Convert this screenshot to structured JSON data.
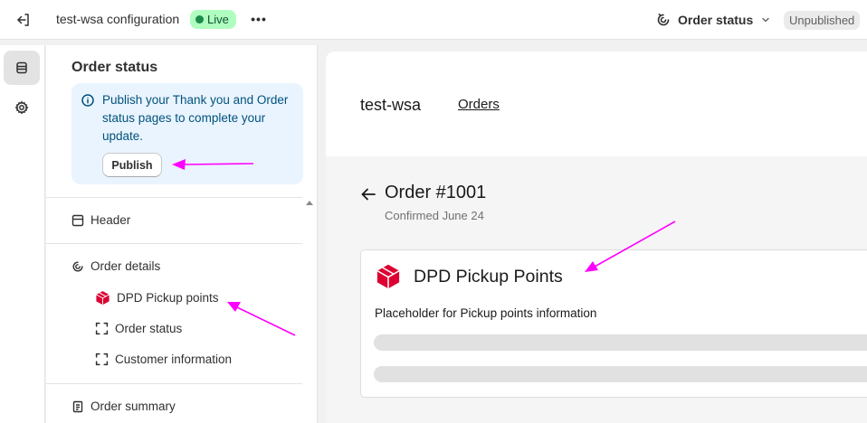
{
  "topbar": {
    "theme_name": "test-wsa configuration",
    "live_label": "Live",
    "page_select_label": "Order status",
    "unpublished_label": "Unpublished"
  },
  "sidebar": {
    "title": "Order status",
    "banner": {
      "text": "Publish your Thank you and Order status pages to complete your update.",
      "button_label": "Publish"
    },
    "sections": {
      "header": "Header",
      "order_details": "Order details",
      "order_summary": "Order summary"
    },
    "blocks": [
      {
        "label": "DPD Pickup points",
        "icon": "dpd-icon"
      },
      {
        "label": "Order status",
        "icon": "block-placeholder-icon"
      },
      {
        "label": "Customer information",
        "icon": "block-placeholder-icon"
      }
    ]
  },
  "preview": {
    "shop_name": "test-wsa",
    "orders_link": "Orders",
    "order_title": "Order #1001",
    "order_subtitle": "Confirmed June 24",
    "card_title": "DPD Pickup Points",
    "card_description": "Placeholder for Pickup points information"
  },
  "colors": {
    "annotation_arrow": "#ff00ff",
    "dpd_red": "#dc0032",
    "live_badge_bg": "#affebf",
    "banner_bg": "#eaf4ff"
  }
}
